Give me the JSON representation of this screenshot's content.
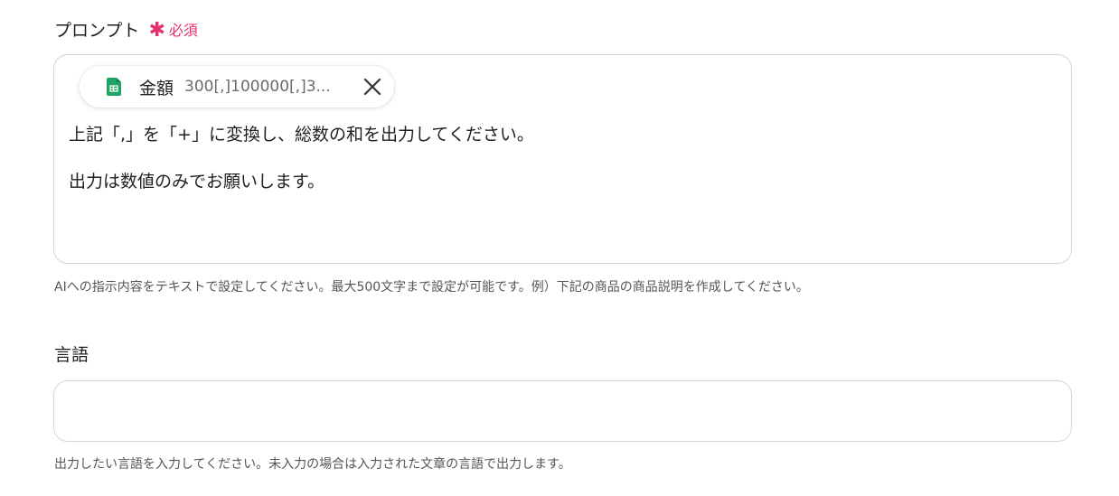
{
  "prompt_field": {
    "label": "プロンプト",
    "required_star": "✱",
    "required_label": "必須",
    "chip": {
      "name": "金額",
      "value": "300[,]100000[,]3...",
      "icon": "google-sheets-icon",
      "icon_color": "#1fa463"
    },
    "lines": [
      "上記「,」を「+」に変換し、総数の和を出力してください。",
      "出力は数値のみでお願いします。"
    ],
    "help": "AIへの指示内容をテキストで設定してください。最大500文字まで設定が可能です。例）下記の商品の商品説明を作成してください。"
  },
  "language_field": {
    "label": "言語",
    "value": "",
    "help": "出力したい言語を入力してください。未入力の場合は入力された文章の言語で出力します。"
  },
  "colors": {
    "required": "#e5336a",
    "border": "#d6d6d6"
  }
}
